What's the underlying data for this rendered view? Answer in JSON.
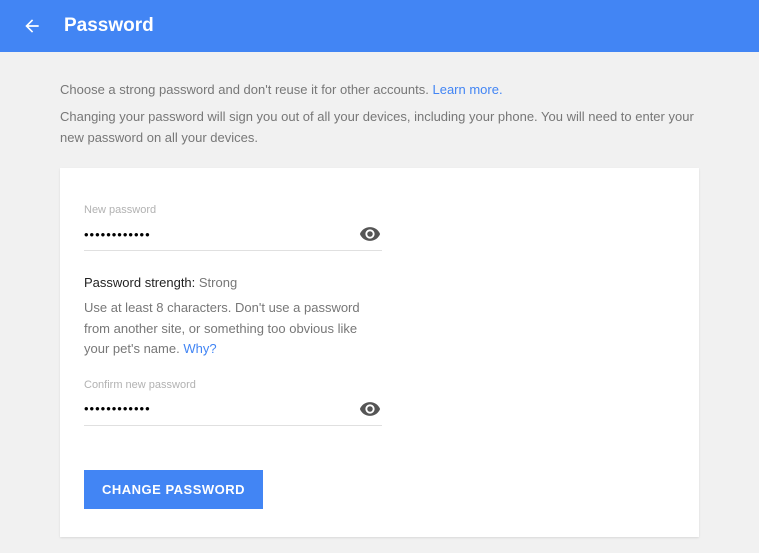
{
  "header": {
    "title": "Password"
  },
  "intro": {
    "line1": "Choose a strong password and don't reuse it for other accounts. ",
    "learn_more": "Learn more.",
    "line2": "Changing your password will sign you out of all your devices, including your phone. You will need to enter your new password on all your devices."
  },
  "form": {
    "new_password": {
      "label": "New password",
      "value": "••••••••••••"
    },
    "strength": {
      "label": "Password strength: ",
      "value": "Strong"
    },
    "hint": {
      "text": "Use at least 8 characters. Don't use a password from another site, or something too obvious like your pet's name. ",
      "why": "Why?"
    },
    "confirm_password": {
      "label": "Confirm new password",
      "value": "••••••••••••"
    },
    "submit_label": "CHANGE PASSWORD"
  }
}
